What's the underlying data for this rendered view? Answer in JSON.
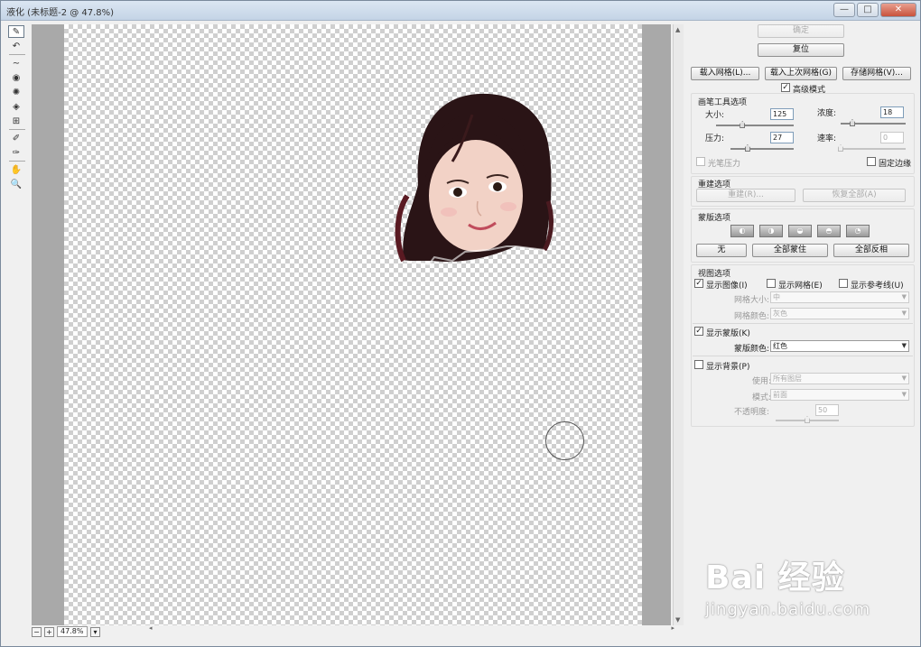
{
  "window": {
    "title": "液化 (未标题-2 @ 47.8%)",
    "buttons": {
      "minimize": "—",
      "maximize": "□",
      "close": "✕"
    }
  },
  "tools": [
    {
      "name": "forward-warp-tool",
      "icon": "✎"
    },
    {
      "name": "reconstruct-tool",
      "icon": "↶"
    },
    {
      "name": "smooth-tool",
      "icon": "∼"
    },
    {
      "name": "twirl-tool",
      "icon": "◉"
    },
    {
      "name": "pucker-tool",
      "icon": "✺"
    },
    {
      "name": "bloat-tool",
      "icon": "◈"
    },
    {
      "name": "push-left-tool",
      "icon": "⊞"
    },
    {
      "name": "freeze-mask-tool",
      "icon": "✐"
    },
    {
      "name": "thaw-mask-tool",
      "icon": "✑"
    },
    {
      "name": "hand-tool",
      "icon": "✋"
    },
    {
      "name": "zoom-tool",
      "icon": "🔍"
    }
  ],
  "status": {
    "zoom_value": "47.8%",
    "minus": "−",
    "plus": "+",
    "dropdown": "▾"
  },
  "panel": {
    "ok": "确定",
    "reset": "复位",
    "load_mesh": "载入网格(L)...",
    "load_last_mesh": "载入上次网格(G)",
    "save_mesh": "存储网格(V)...",
    "advanced_mode": "高级模式",
    "brush_options": {
      "title": "画笔工具选项",
      "size_label": "大小:",
      "size_value": "125",
      "density_label": "浓度:",
      "density_value": "18",
      "pressure_label": "压力:",
      "pressure_value": "27",
      "rate_label": "速率:",
      "rate_value": "0",
      "stylus_pressure": "光笔压力",
      "pin_edges": "固定边缘",
      "size_fraction": 0.34,
      "density_fraction": 0.18,
      "pressure_fraction": 0.27,
      "rate_fraction": 0
    },
    "reconstruct_options": {
      "title": "重建选项",
      "reconstruct": "重建(R)...",
      "restore_all": "恢复全部(A)"
    },
    "mask_options": {
      "title": "蒙版选项",
      "none": "无",
      "mask_all": "全部蒙住",
      "invert_all": "全部反相"
    },
    "view_options": {
      "title": "视图选项",
      "show_image": "显示图像(I)",
      "show_mesh": "显示网格(E)",
      "show_guides": "显示参考线(U)",
      "mesh_size_label": "网格大小:",
      "mesh_size_value": "中",
      "mesh_color_label": "网格颜色:",
      "mesh_color_value": "灰色",
      "show_mask": "显示蒙版(K)",
      "mask_color_label": "蒙版颜色:",
      "mask_color_value": "红色",
      "show_backdrop": "显示背景(P)",
      "use_label": "使用:",
      "use_value": "所有图层",
      "mode_label": "模式:",
      "mode_value": "前面",
      "opacity_label": "不透明度:",
      "opacity_value": "50",
      "opacity_fraction": 0.5
    }
  },
  "watermark": {
    "brand": "Bai 经验",
    "url": "jingyan.baidu.com"
  },
  "colors": {
    "canvas_check": "#cfcfcf",
    "gray_bg": "#a9a9a9",
    "panel_bg": "#f0f0f0"
  }
}
